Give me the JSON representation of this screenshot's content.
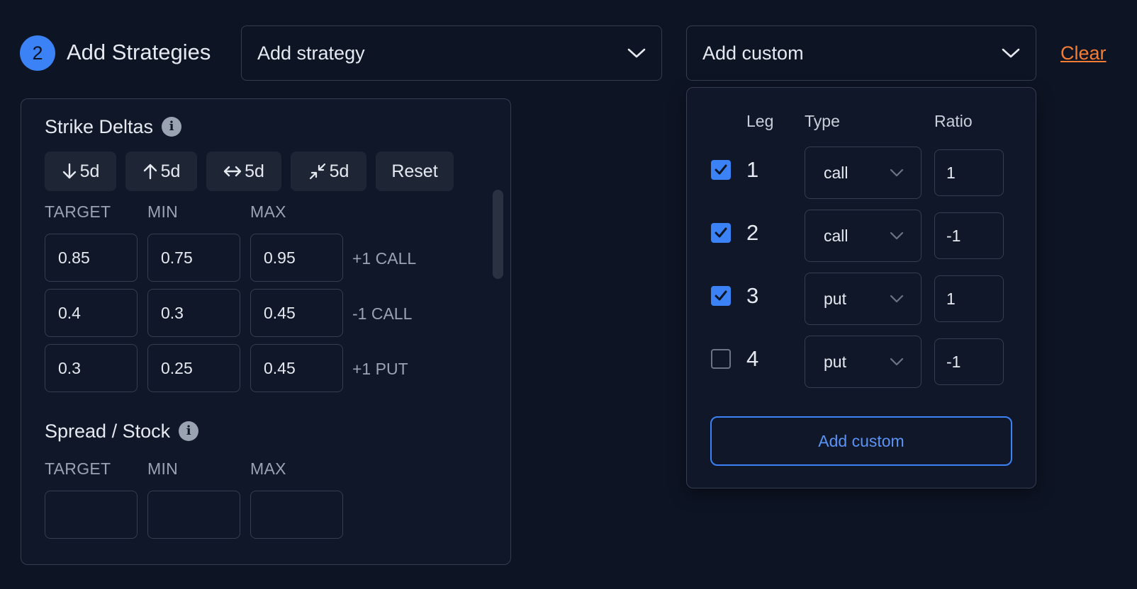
{
  "header": {
    "step_number": "2",
    "title": "Add Strategies",
    "strategy_dropdown": "Add strategy",
    "custom_dropdown": "Add custom",
    "clear_label": "Clear"
  },
  "strike_deltas": {
    "title": "Strike Deltas",
    "buttons": [
      "5d",
      "5d",
      "5d",
      "5d",
      "Reset"
    ],
    "col_headers": [
      "TARGET",
      "MIN",
      "MAX"
    ],
    "rows": [
      {
        "target": "0.85",
        "min": "0.75",
        "max": "0.95",
        "leg": "+1 CALL"
      },
      {
        "target": "0.4",
        "min": "0.3",
        "max": "0.45",
        "leg": "-1 CALL"
      },
      {
        "target": "0.3",
        "min": "0.25",
        "max": "0.45",
        "leg": "+1 PUT"
      }
    ]
  },
  "spread_stock": {
    "title": "Spread / Stock",
    "col_headers": [
      "TARGET",
      "MIN",
      "MAX"
    ],
    "row": {
      "target": "",
      "min": "",
      "max": ""
    }
  },
  "custom_popover": {
    "headers": {
      "leg": "Leg",
      "type": "Type",
      "ratio": "Ratio"
    },
    "legs": [
      {
        "checked": true,
        "leg": "1",
        "type": "call",
        "ratio": "1"
      },
      {
        "checked": true,
        "leg": "2",
        "type": "call",
        "ratio": "-1"
      },
      {
        "checked": true,
        "leg": "3",
        "type": "put",
        "ratio": "1"
      },
      {
        "checked": false,
        "leg": "4",
        "type": "put",
        "ratio": "-1"
      }
    ],
    "button_label": "Add custom"
  },
  "colors": {
    "background": "#0d1424",
    "accent": "#3b82f6",
    "clear_link": "#f47c34",
    "border": "#353e50"
  }
}
